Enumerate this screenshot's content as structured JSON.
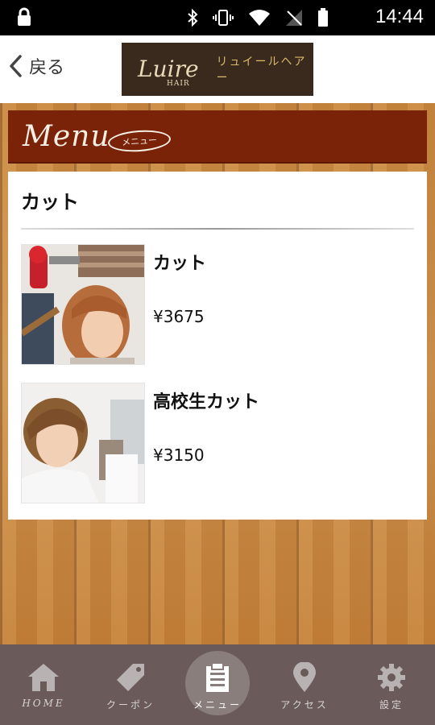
{
  "status_bar": {
    "time": "14:44"
  },
  "header": {
    "back_label": "戻る",
    "logo_script": "Luire",
    "logo_small": "HAIR",
    "logo_kana": "リュイールヘアー"
  },
  "menu_banner": {
    "script": "Menu",
    "sub": "メニュー"
  },
  "section": {
    "title": "カット",
    "items": [
      {
        "name": "カット",
        "price": "¥3675"
      },
      {
        "name": "高校生カット",
        "price": "¥3150"
      }
    ]
  },
  "bottom_nav": [
    {
      "label": "HOME",
      "icon": "home-icon"
    },
    {
      "label": "クーポン",
      "icon": "tag-icon"
    },
    {
      "label": "メニュー",
      "icon": "menu-clipboard-icon",
      "active": true
    },
    {
      "label": "アクセス",
      "icon": "map-pin-icon"
    },
    {
      "label": "設定",
      "icon": "gear-icon"
    }
  ],
  "colors": {
    "banner": "#7a2308",
    "nav_bg": "#6a5b5a",
    "wood": "#c8873f"
  }
}
